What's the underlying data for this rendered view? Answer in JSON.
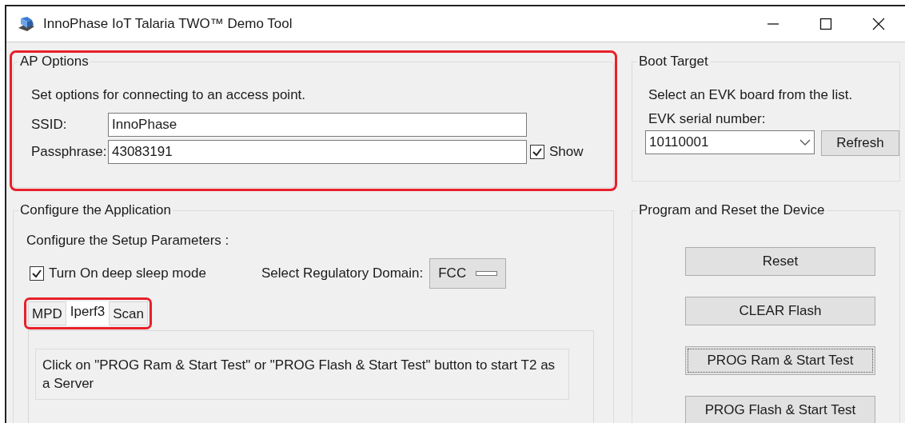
{
  "window": {
    "title": "InnoPhase IoT Talaria TWO™ Demo Tool"
  },
  "ap_options": {
    "title": "AP Options",
    "highlighted": true,
    "description": "Set options for connecting to an access point.",
    "fields": [
      {
        "label": "SSID:",
        "value": "InnoPhase"
      },
      {
        "label": "Passphrase:",
        "value": "43083191"
      }
    ],
    "show_checkbox": {
      "label": "Show",
      "checked": true
    }
  },
  "boot_target": {
    "title": "Boot Target",
    "description": "Select an EVK board from the list.",
    "serial_label": "EVK serial number:",
    "serial_value": "10110001",
    "refresh_button": "Refresh"
  },
  "configure": {
    "title": "Configure the Application",
    "subtitle": "Configure the Setup Parameters :",
    "deep_sleep": {
      "label": "Turn On deep sleep mode",
      "checked": true
    },
    "regulatory": {
      "label": "Select Regulatory Domain:",
      "value": "FCC"
    },
    "tabs_highlighted": true,
    "tabs": [
      {
        "label": "MPD",
        "selected": false
      },
      {
        "label": "Iperf3",
        "selected": true
      },
      {
        "label": "Scan",
        "selected": false
      }
    ],
    "panel_text": "Click on \"PROG Ram & Start Test\" or \"PROG Flash & Start Test\" button to start T2 as a Server"
  },
  "program": {
    "title": "Program and Reset the Device",
    "buttons": [
      {
        "label": "Reset",
        "focused": false
      },
      {
        "label": "CLEAR Flash",
        "focused": false
      },
      {
        "label": "PROG Ram & Start Test",
        "focused": true
      },
      {
        "label": "PROG Flash & Start Test",
        "focused": false
      }
    ]
  }
}
